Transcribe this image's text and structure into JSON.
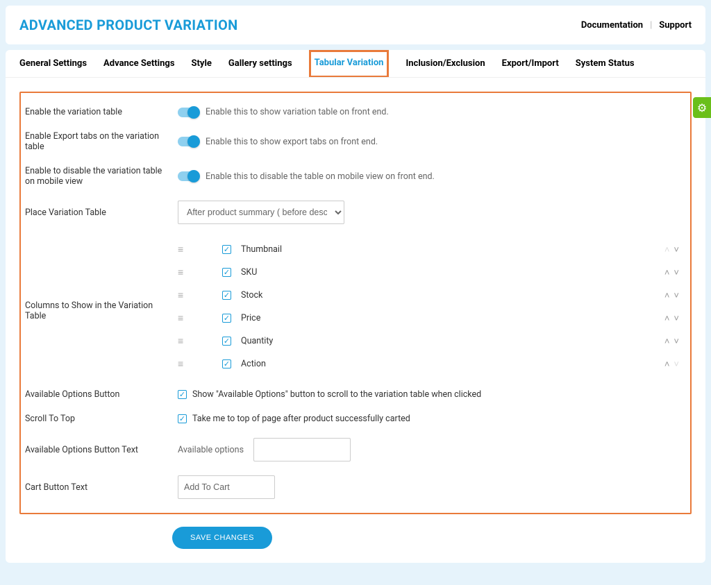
{
  "header": {
    "title": "ADVANCED PRODUCT VARIATION",
    "doc_link": "Documentation",
    "support_link": "Support"
  },
  "tabs": {
    "general": "General Settings",
    "advance": "Advance Settings",
    "style": "Style",
    "gallery": "Gallery settings",
    "tabular": "Tabular Variation",
    "incexc": "Inclusion/Exclusion",
    "expimp": "Export/Import",
    "system": "System Status"
  },
  "fields": {
    "enable_table": {
      "label": "Enable the variation table",
      "desc": "Enable this to show variation table on front end."
    },
    "enable_export": {
      "label": "Enable Export tabs on the variation table",
      "desc": "Enable this to show export tabs on front end."
    },
    "enable_mobile": {
      "label": "Enable to disable the variation table on mobile view",
      "desc": "Enable this to disable the table on mobile view on front end."
    },
    "place_table": {
      "label": "Place Variation Table",
      "value": "After product summary ( before description )"
    },
    "columns_label": "Columns to Show in the Variation Table",
    "available_btn": {
      "label": "Available Options Button",
      "desc": "Show \"Available Options\" button to scroll to the variation table when clicked"
    },
    "scroll_top": {
      "label": "Scroll To Top",
      "desc": "Take me to top of page after product successfully carted"
    },
    "available_text": {
      "label": "Available Options Button Text",
      "inline_label": "Available options",
      "value": ""
    },
    "cart_text": {
      "label": "Cart Button Text",
      "value": "Add To Cart"
    }
  },
  "columns": [
    {
      "name": "Thumbnail",
      "up_disabled": true,
      "down_disabled": false
    },
    {
      "name": "SKU",
      "up_disabled": false,
      "down_disabled": false
    },
    {
      "name": "Stock",
      "up_disabled": false,
      "down_disabled": false
    },
    {
      "name": "Price",
      "up_disabled": false,
      "down_disabled": false
    },
    {
      "name": "Quantity",
      "up_disabled": false,
      "down_disabled": false
    },
    {
      "name": "Action",
      "up_disabled": false,
      "down_disabled": true
    }
  ],
  "buttons": {
    "save": "SAVE CHANGES"
  }
}
